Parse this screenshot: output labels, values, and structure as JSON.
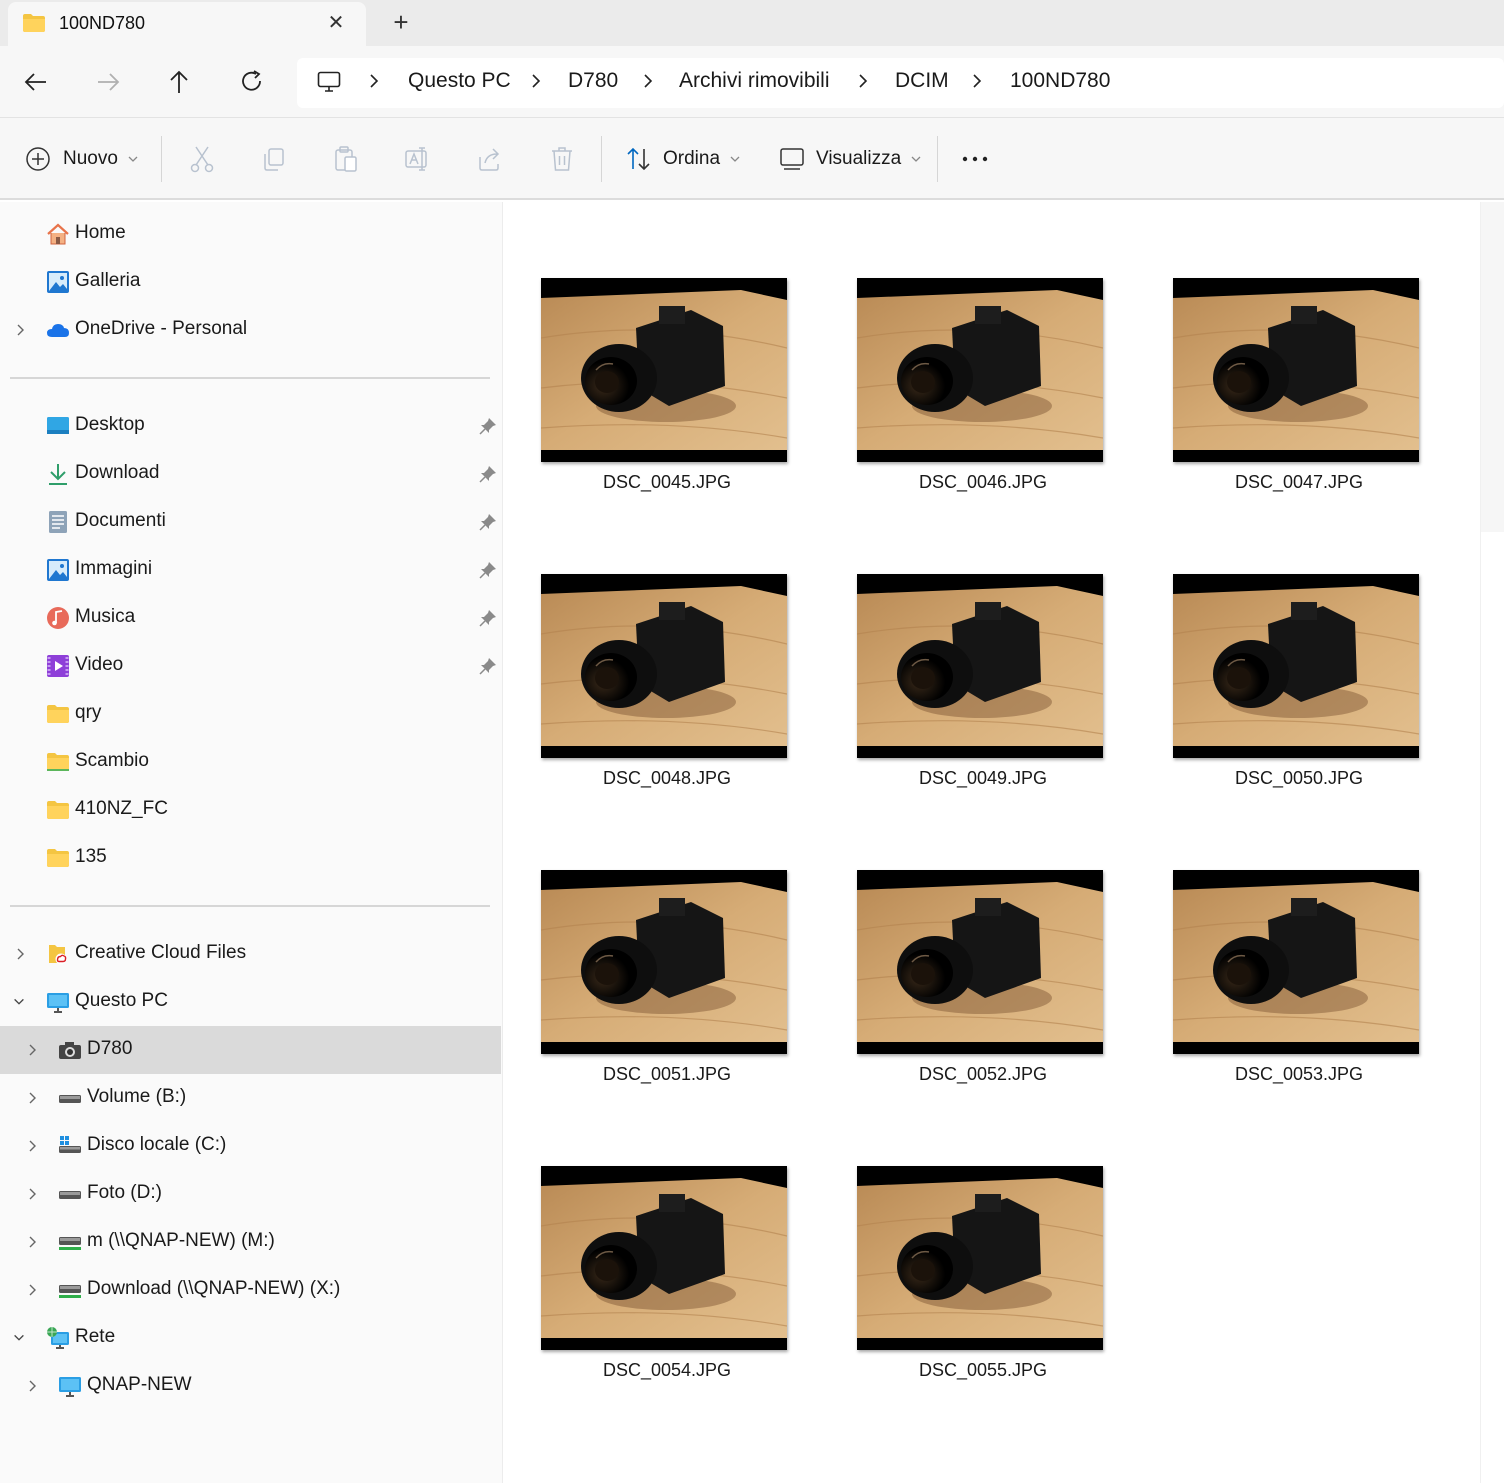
{
  "tab": {
    "title": "100ND780",
    "close_symbol": "✕",
    "new_symbol": "+"
  },
  "breadcrumb": [
    "Questo PC",
    "D780",
    "Archivi rimovibili",
    "DCIM",
    "100ND780"
  ],
  "commands": {
    "new": "Nuovo",
    "sort": "Ordina",
    "view": "Visualizza"
  },
  "sidebar": {
    "quick": [
      {
        "label": "Home",
        "icon": "home-icon"
      },
      {
        "label": "Galleria",
        "icon": "gallery-icon"
      },
      {
        "label": "OneDrive - Personal",
        "icon": "onedrive-cloud-icon"
      }
    ],
    "pinned": [
      {
        "label": "Desktop",
        "icon": "desktop-icon",
        "pinned": true
      },
      {
        "label": "Download",
        "icon": "download-arrow-icon",
        "pinned": true
      },
      {
        "label": "Documenti",
        "icon": "document-icon",
        "pinned": true
      },
      {
        "label": "Immagini",
        "icon": "pictures-icon",
        "pinned": true
      },
      {
        "label": "Musica",
        "icon": "music-icon",
        "pinned": true
      },
      {
        "label": "Video",
        "icon": "video-icon",
        "pinned": true
      },
      {
        "label": "qry",
        "icon": "folder-icon"
      },
      {
        "label": "Scambio",
        "icon": "folder-icon"
      },
      {
        "label": "410NZ_FC",
        "icon": "folder-icon"
      },
      {
        "label": "135",
        "icon": "folder-icon"
      }
    ],
    "tree": [
      {
        "label": "Creative Cloud Files",
        "icon": "creative-cloud-folder-icon"
      },
      {
        "label": "Questo PC",
        "icon": "this-pc-monitor-icon"
      },
      {
        "label": "D780",
        "icon": "camera-icon",
        "selected": true
      },
      {
        "label": "Volume (B:)",
        "icon": "drive-icon"
      },
      {
        "label": "Disco locale (C:)",
        "icon": "windows-drive-icon"
      },
      {
        "label": "Foto (D:)",
        "icon": "drive-icon"
      },
      {
        "label": "m (\\\\QNAP-NEW) (M:)",
        "icon": "network-drive-icon"
      },
      {
        "label": "Download (\\\\QNAP-NEW) (X:)",
        "icon": "network-drive-icon"
      },
      {
        "label": "Rete",
        "icon": "network-globe-icon"
      },
      {
        "label": "QNAP-NEW",
        "icon": "computer-icon"
      }
    ]
  },
  "files": [
    "DSC_0045.JPG",
    "DSC_0046.JPG",
    "DSC_0047.JPG",
    "DSC_0048.JPG",
    "DSC_0049.JPG",
    "DSC_0050.JPG",
    "DSC_0051.JPG",
    "DSC_0052.JPG",
    "DSC_0053.JPG",
    "DSC_0054.JPG",
    "DSC_0055.JPG"
  ],
  "colors": {
    "accent": "#0067c0",
    "folder": "#f4c542",
    "selected": "#dadada",
    "wood": "#c99a62"
  }
}
